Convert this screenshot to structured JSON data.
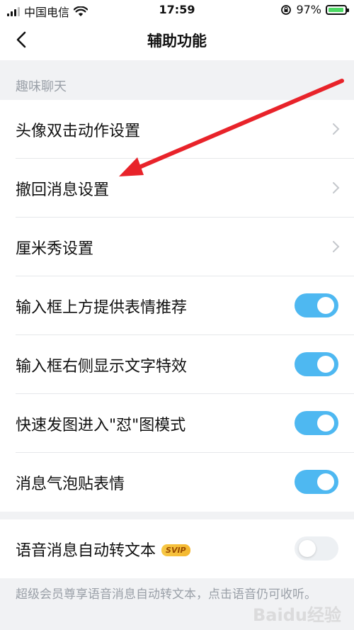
{
  "status_bar": {
    "carrier": "中国电信",
    "time": "17:59",
    "battery": "97%"
  },
  "nav": {
    "title": "辅助功能"
  },
  "section_fun_chat": {
    "header": "趣味聊天"
  },
  "rows": [
    {
      "label": "头像双击动作设置",
      "control": "chevron"
    },
    {
      "label": "撤回消息设置",
      "control": "chevron"
    },
    {
      "label": "厘米秀设置",
      "control": "chevron"
    },
    {
      "label": "输入框上方提供表情推荐",
      "control": "toggle",
      "on": true
    },
    {
      "label": "输入框右侧显示文字特效",
      "control": "toggle",
      "on": true
    },
    {
      "label": "快速发图进入\"怼\"图模式",
      "control": "toggle",
      "on": true
    },
    {
      "label": "消息气泡贴表情",
      "control": "toggle",
      "on": true
    }
  ],
  "voice_row": {
    "label": "语音消息自动转文本",
    "badge": "SVIP",
    "control": "toggle",
    "on": false
  },
  "footer": {
    "text": "超级会员尊享语音消息自动转文本，点击语音仍可收听。"
  },
  "watermark": "Baidu经验",
  "colors": {
    "accent": "#4eb8f1",
    "annotation_arrow": "#e8232a",
    "background": "#f1f2f4"
  }
}
